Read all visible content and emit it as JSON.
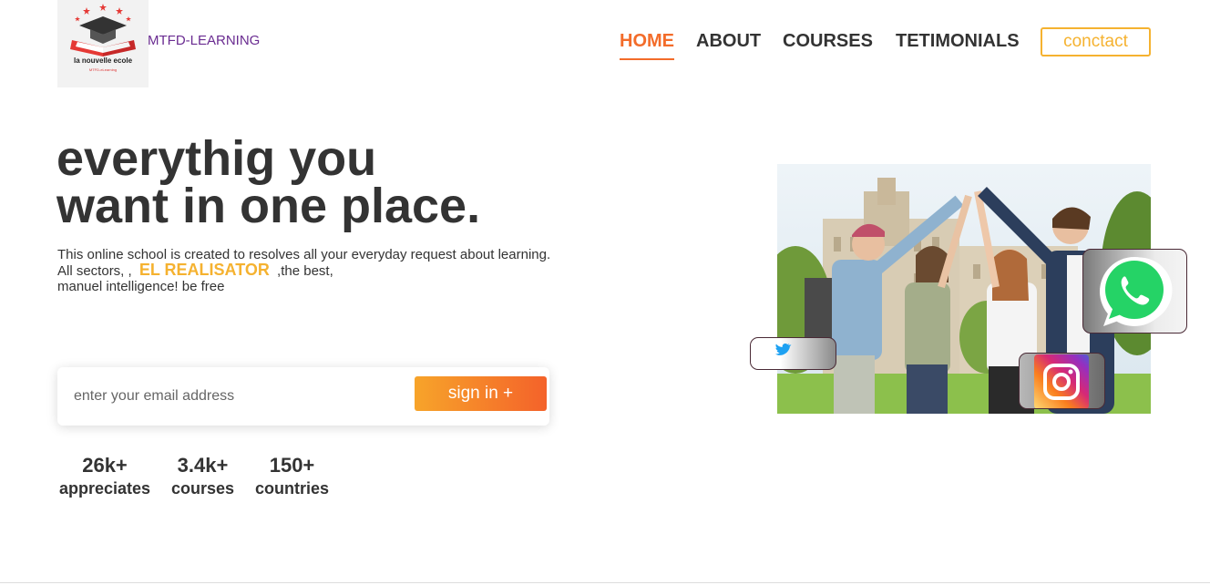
{
  "brand": {
    "logo_school": "la nouvelle ecole",
    "logo_tag": "MTFD-eLearning",
    "name": "MTFD-LEARNING"
  },
  "nav": {
    "items": [
      {
        "label": "HOME",
        "active": true
      },
      {
        "label": "ABOUT",
        "active": false
      },
      {
        "label": "COURSES",
        "active": false
      },
      {
        "label": "TETIMONIALS",
        "active": false
      }
    ],
    "contact_label": "conctact"
  },
  "hero": {
    "title_line1": "everythig you",
    "title_line2": "want in one place.",
    "desc_line1": "This online school is created to resolves all your everyday request about learning.",
    "desc_line2_pre": "All sectors, ,",
    "desc_highlight": "EL REALISATOR",
    "desc_line2_post": ",the best,",
    "desc_line3": "manuel intelligence! be free"
  },
  "signup": {
    "email_placeholder": "enter your email address",
    "email_value": "",
    "button_label": "sign in +"
  },
  "stats": [
    {
      "value": "26k+",
      "label": "appreciates"
    },
    {
      "value": "3.4k+",
      "label": "courses"
    },
    {
      "value": "150+",
      "label": "countries"
    }
  ],
  "social": {
    "icons": [
      "twitter-icon",
      "instagram-icon",
      "whatsapp-icon"
    ]
  },
  "colors": {
    "accent_orange": "#f36c2a",
    "highlight_yellow": "#f5b230",
    "brand_purple": "#6a2c91",
    "text_dark": "#333333",
    "whatsapp_green": "#25d366",
    "twitter_blue": "#1da1f2"
  }
}
